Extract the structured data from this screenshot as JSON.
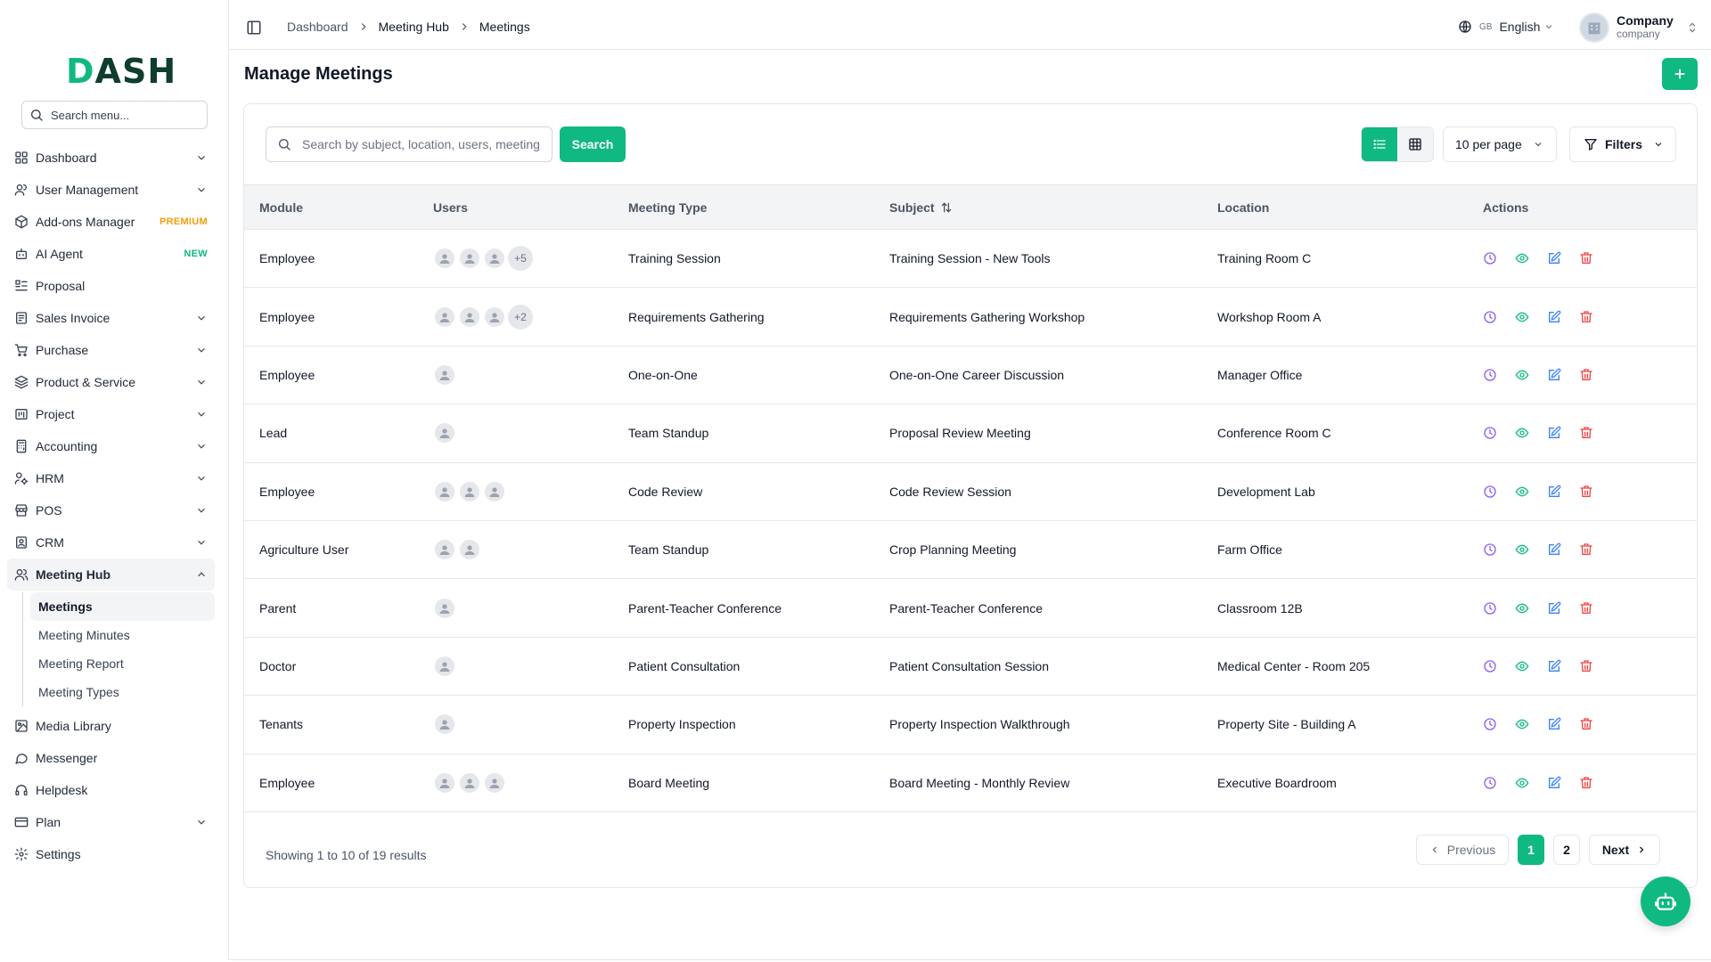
{
  "brand": {
    "logo_text": "DASH"
  },
  "sidebar": {
    "search_placeholder": "Search menu...",
    "items": [
      {
        "label": "Dashboard",
        "icon": "dashboard-icon",
        "has_chevron": true
      },
      {
        "label": "User Management",
        "icon": "users-icon",
        "has_chevron": true
      },
      {
        "label": "Add-ons Manager",
        "icon": "package-icon",
        "badge": "PREMIUM"
      },
      {
        "label": "AI Agent",
        "icon": "bot-icon",
        "badge": "NEW"
      },
      {
        "label": "Proposal",
        "icon": "proposal-icon"
      },
      {
        "label": "Sales Invoice",
        "icon": "invoice-icon",
        "has_chevron": true
      },
      {
        "label": "Purchase",
        "icon": "cart-icon",
        "has_chevron": true
      },
      {
        "label": "Product & Service",
        "icon": "layers-icon",
        "has_chevron": true
      },
      {
        "label": "Project",
        "icon": "project-icon",
        "has_chevron": true
      },
      {
        "label": "Accounting",
        "icon": "calculator-icon",
        "has_chevron": true
      },
      {
        "label": "HRM",
        "icon": "hrm-icon",
        "has_chevron": true
      },
      {
        "label": "POS",
        "icon": "store-icon",
        "has_chevron": true
      },
      {
        "label": "CRM",
        "icon": "crm-icon",
        "has_chevron": true
      },
      {
        "label": "Meeting Hub",
        "icon": "meeting-icon",
        "has_chevron": true,
        "expanded": true
      }
    ],
    "meeting_hub_sub": [
      "Meetings",
      "Meeting Minutes",
      "Meeting Report",
      "Meeting Types"
    ],
    "items_after": [
      {
        "label": "Media Library",
        "icon": "image-icon"
      },
      {
        "label": "Messenger",
        "icon": "chat-icon"
      },
      {
        "label": "Helpdesk",
        "icon": "headset-icon"
      },
      {
        "label": "Plan",
        "icon": "card-icon",
        "has_chevron": true
      },
      {
        "label": "Settings",
        "icon": "gear-icon"
      }
    ]
  },
  "topbar": {
    "breadcrumb": [
      "Dashboard",
      "Meeting Hub",
      "Meetings"
    ],
    "language_flag": "GB",
    "language": "English",
    "company_name": "Company",
    "company_role": "company"
  },
  "page": {
    "title": "Manage Meetings",
    "search_placeholder": "Search by subject, location, users, meeting type...",
    "search_button": "Search",
    "per_page": "10 per page",
    "filters_label": "Filters"
  },
  "table": {
    "columns": [
      "Module",
      "Users",
      "Meeting Type",
      "Subject",
      "Location",
      "Actions"
    ],
    "rows": [
      {
        "module": "Employee",
        "avatars": 3,
        "more": "+5",
        "meeting_type": "Training Session",
        "subject": "Training Session - New Tools",
        "location": "Training Room C"
      },
      {
        "module": "Employee",
        "avatars": 3,
        "more": "+2",
        "meeting_type": "Requirements Gathering",
        "subject": "Requirements Gathering Workshop",
        "location": "Workshop Room A"
      },
      {
        "module": "Employee",
        "avatars": 1,
        "more": "",
        "meeting_type": "One-on-One",
        "subject": "One-on-One Career Discussion",
        "location": "Manager Office"
      },
      {
        "module": "Lead",
        "avatars": 1,
        "more": "",
        "meeting_type": "Team Standup",
        "subject": "Proposal Review Meeting",
        "location": "Conference Room C"
      },
      {
        "module": "Employee",
        "avatars": 3,
        "more": "",
        "meeting_type": "Code Review",
        "subject": "Code Review Session",
        "location": "Development Lab"
      },
      {
        "module": "Agriculture User",
        "avatars": 2,
        "more": "",
        "meeting_type": "Team Standup",
        "subject": "Crop Planning Meeting",
        "location": "Farm Office"
      },
      {
        "module": "Parent",
        "avatars": 1,
        "more": "",
        "meeting_type": "Parent-Teacher Conference",
        "subject": "Parent-Teacher Conference",
        "location": "Classroom 12B"
      },
      {
        "module": "Doctor",
        "avatars": 1,
        "more": "",
        "meeting_type": "Patient Consultation",
        "subject": "Patient Consultation Session",
        "location": "Medical Center - Room 205"
      },
      {
        "module": "Tenants",
        "avatars": 1,
        "more": "",
        "meeting_type": "Property Inspection",
        "subject": "Property Inspection Walkthrough",
        "location": "Property Site - Building A"
      },
      {
        "module": "Employee",
        "avatars": 3,
        "more": "",
        "meeting_type": "Board Meeting",
        "subject": "Board Meeting - Monthly Review",
        "location": "Executive Boardroom"
      }
    ]
  },
  "pagination": {
    "summary": "Showing 1 to 10 of 19 results",
    "previous": "Previous",
    "pages": [
      "1",
      "2"
    ],
    "current": "1",
    "next": "Next"
  },
  "colors": {
    "accent": "#10b981",
    "history": "#8b5cf6",
    "view": "#10b981",
    "edit": "#3b82f6",
    "delete": "#ef4444",
    "premium": "#f59e0b"
  }
}
